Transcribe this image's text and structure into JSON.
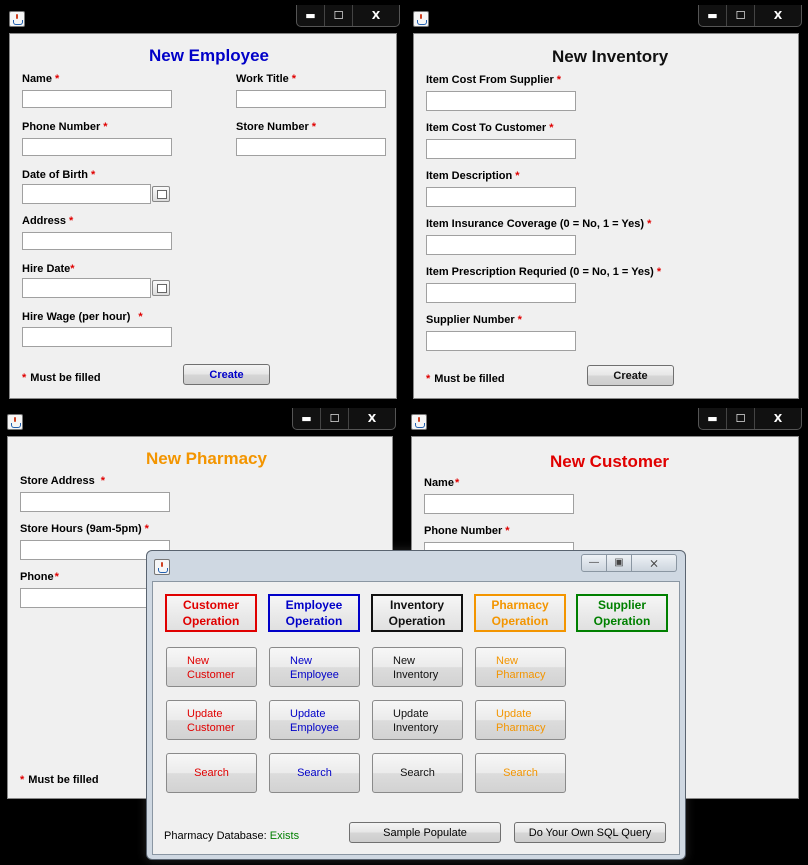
{
  "window_controls": {
    "minimize": "▬",
    "maximize": "☐",
    "close": "X"
  },
  "employee": {
    "title": "New Employee",
    "name_label": "Name",
    "work_title_label": "Work Title",
    "phone_label": "Phone Number",
    "store_label": "Store Number",
    "dob_label": "Date of Birth",
    "address_label": "Address",
    "hire_date_label": "Hire Date",
    "hire_wage_label": "Hire Wage (per hour)",
    "must_fill": "Must be filled",
    "create_label": "Create"
  },
  "inventory": {
    "title": "New Inventory",
    "cost_supplier_label": "Item Cost From Supplier",
    "cost_customer_label": "Item Cost To Customer",
    "description_label": "Item Description",
    "insurance_label": "Item Insurance Coverage (0 = No, 1 = Yes)",
    "prescription_label": "Item Prescription Requried (0 = No, 1 = Yes)",
    "supplier_label": "Supplier Number",
    "must_fill": "Must be filled",
    "create_label": "Create"
  },
  "pharmacy": {
    "title": "New Pharmacy",
    "address_label": "Store Address",
    "hours_label": "Store Hours (9am-5pm)",
    "phone_label": "Phone",
    "must_fill": "Must be filled"
  },
  "customer": {
    "title": "New Customer",
    "name_label": "Name",
    "phone_label": "Phone Number"
  },
  "main": {
    "window_controls": {
      "minimize": "—",
      "maximize": "▣",
      "close": "⨯"
    },
    "headers": {
      "customer": {
        "line1": "Customer",
        "line2": "Operation"
      },
      "employee": {
        "line1": "Employee",
        "line2": "Operation"
      },
      "inventory": {
        "line1": "Inventory",
        "line2": "Operation"
      },
      "pharmacy": {
        "line1": "Pharmacy",
        "line2": "Operation"
      },
      "supplier": {
        "line1": "Supplier",
        "line2": "Operation"
      }
    },
    "buttons": {
      "new_customer": {
        "line1": "New",
        "line2": "Customer"
      },
      "new_employee": {
        "line1": "New",
        "line2": "Employee"
      },
      "new_inventory": {
        "line1": "New",
        "line2": "Inventory"
      },
      "new_pharmacy": {
        "line1": "New",
        "line2": "Pharmacy"
      },
      "update_customer": {
        "line1": "Update",
        "line2": "Customer"
      },
      "update_employee": {
        "line1": "Update",
        "line2": "Employee"
      },
      "update_inventory": {
        "line1": "Update",
        "line2": "Inventory"
      },
      "update_pharmacy": {
        "line1": "Update",
        "line2": "Pharmacy"
      },
      "search_customer": "Search",
      "search_employee": "Search",
      "search_inventory": "Search",
      "search_pharmacy": "Search"
    },
    "db_status_label": "Pharmacy Database:",
    "db_status_value": "Exists",
    "sample_populate": "Sample Populate",
    "sql_query": "Do Your Own SQL Query"
  },
  "colors": {
    "customer": "#e00000",
    "employee": "#0000c8",
    "inventory": "#111111",
    "pharmacy": "#f39500",
    "supplier": "#008000",
    "required": "#e00000"
  },
  "icons": [
    "java-app-icon",
    "calendar-icon"
  ]
}
